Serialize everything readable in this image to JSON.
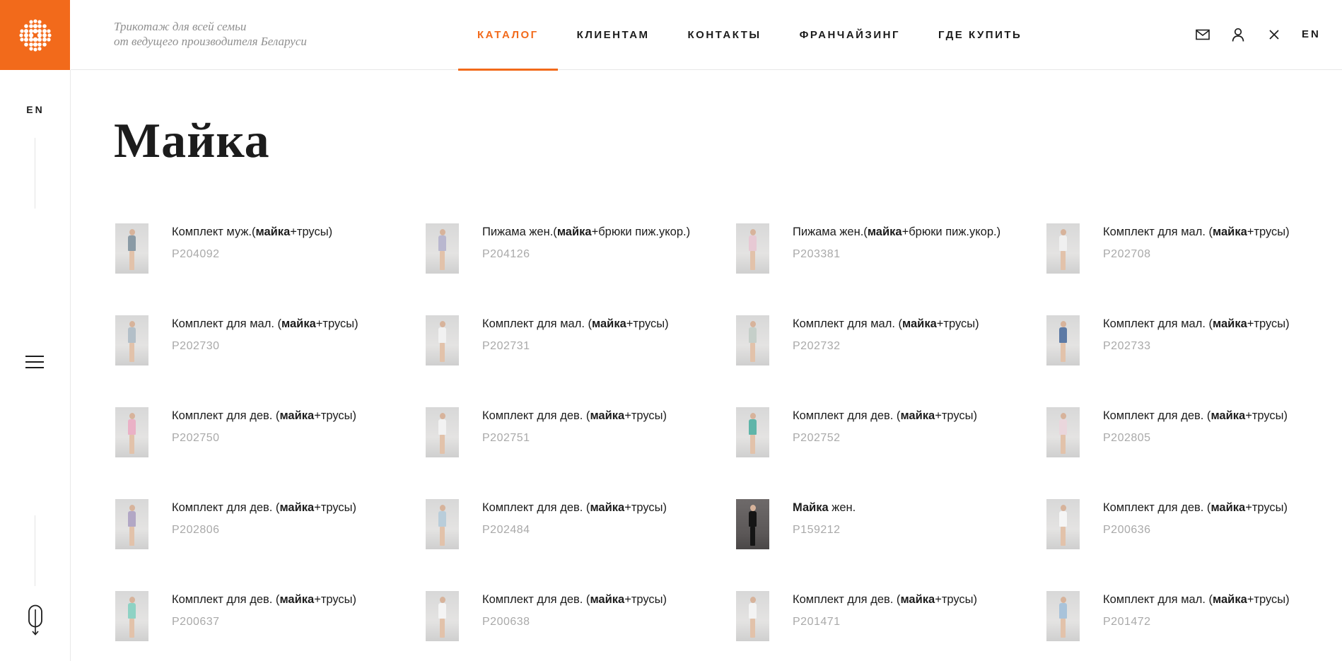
{
  "brand": {
    "tagline_line1": "Трикотаж для всей семьи",
    "tagline_line2": "от ведущего производителя Беларуси",
    "accent_color": "#f26a1b"
  },
  "nav": {
    "items": [
      {
        "label": "КАТАЛОГ",
        "active": true
      },
      {
        "label": "КЛИЕНТАМ",
        "active": false
      },
      {
        "label": "КОНТАКТЫ",
        "active": false
      },
      {
        "label": "ФРАНЧАЙЗИНГ",
        "active": false
      },
      {
        "label": "ГДЕ КУПИТЬ",
        "active": false
      }
    ]
  },
  "header_icons": [
    "mail-icon",
    "user-icon",
    "close-icon"
  ],
  "header_lang": "EN",
  "sidebar": {
    "lang": "EN",
    "menu_icon": "hamburger-icon",
    "scroll_icon": "mouse-scroll-icon"
  },
  "page": {
    "title": "Майка"
  },
  "products": [
    {
      "pre": "Комплект муж.(",
      "bold": "майка",
      "post": "+трусы)",
      "sku": "P204092",
      "top": "#8a9aa5",
      "dark": false
    },
    {
      "pre": "Пижама жен.(",
      "bold": "майка",
      "post": "+брюки пиж.укор.)",
      "sku": "P204126",
      "top": "#b9b7cf",
      "dark": false
    },
    {
      "pre": "Пижама жен.(",
      "bold": "майка",
      "post": "+брюки пиж.укор.)",
      "sku": "P203381",
      "top": "#e7c9d4",
      "dark": false
    },
    {
      "pre": "Комплект для мал. (",
      "bold": "майка",
      "post": "+трусы)",
      "sku": "P202708",
      "top": "#f0f0f0",
      "dark": false
    },
    {
      "pre": "Комплект для мал. (",
      "bold": "майка",
      "post": "+трусы)",
      "sku": "P202730",
      "top": "#b3bfc8",
      "dark": false
    },
    {
      "pre": "Комплект для мал. (",
      "bold": "майка",
      "post": "+трусы)",
      "sku": "P202731",
      "top": "#f1f1f1",
      "dark": false
    },
    {
      "pre": "Комплект для мал. (",
      "bold": "майка",
      "post": "+трусы)",
      "sku": "P202732",
      "top": "#c5cfc9",
      "dark": false
    },
    {
      "pre": "Комплект для мал. (",
      "bold": "майка",
      "post": "+трусы)",
      "sku": "P202733",
      "top": "#5d7aa5",
      "dark": false
    },
    {
      "pre": "Комплект для дев. (",
      "bold": "майка",
      "post": "+трусы)",
      "sku": "P202750",
      "top": "#eab1c6",
      "dark": false
    },
    {
      "pre": "Комплект для дев. (",
      "bold": "майка",
      "post": "+трусы)",
      "sku": "P202751",
      "top": "#f2f2f2",
      "dark": false
    },
    {
      "pre": "Комплект для дев. (",
      "bold": "майка",
      "post": "+трусы)",
      "sku": "P202752",
      "top": "#5fb5a9",
      "dark": false
    },
    {
      "pre": "Комплект для дев. (",
      "bold": "майка",
      "post": "+трусы)",
      "sku": "P202805",
      "top": "#ead6dc",
      "dark": false
    },
    {
      "pre": "Комплект для дев. (",
      "bold": "майка",
      "post": "+трусы)",
      "sku": "P202806",
      "top": "#b2a7c5",
      "dark": false
    },
    {
      "pre": "Комплект для дев. (",
      "bold": "майка",
      "post": "+трусы)",
      "sku": "P202484",
      "top": "#b9cdda",
      "dark": false
    },
    {
      "pre": "",
      "bold": "Майка",
      "post": " жен.",
      "sku": "P159212",
      "top": "#151515",
      "dark": true
    },
    {
      "pre": "Комплект для дев. (",
      "bold": "майка",
      "post": "+трусы)",
      "sku": "P200636",
      "top": "#f5f5f5",
      "dark": false
    },
    {
      "pre": "Комплект для дев. (",
      "bold": "майка",
      "post": "+трусы)",
      "sku": "P200637",
      "top": "#8ed2c4",
      "dark": false
    },
    {
      "pre": "Комплект для дев. (",
      "bold": "майка",
      "post": "+трусы)",
      "sku": "P200638",
      "top": "#f4f4f4",
      "dark": false
    },
    {
      "pre": "Комплект для дев. (",
      "bold": "майка",
      "post": "+трусы)",
      "sku": "P201471",
      "top": "#f3f3f3",
      "dark": false
    },
    {
      "pre": "Комплект для мал. (",
      "bold": "майка",
      "post": "+трусы)",
      "sku": "P201472",
      "top": "#a9c3da",
      "dark": false
    }
  ]
}
